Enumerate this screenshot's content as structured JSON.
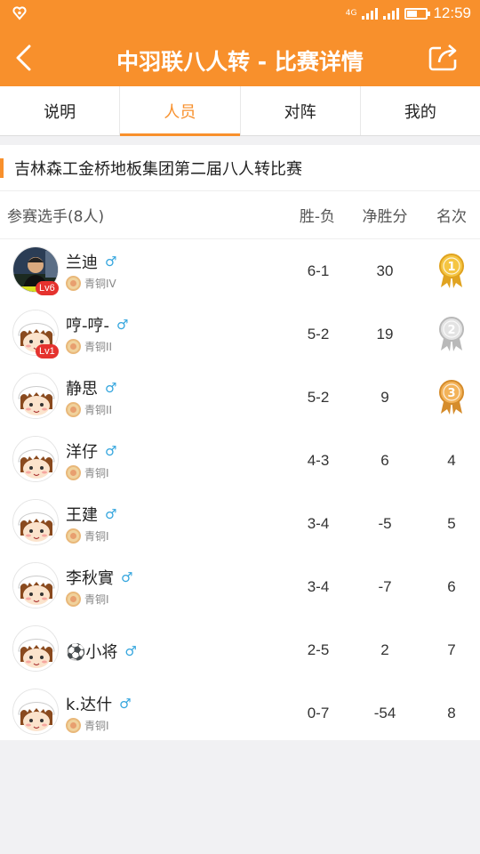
{
  "status_bar": {
    "network": "4G",
    "time": "12:59",
    "battery_level": 0.55
  },
  "navbar": {
    "title": "中羽联八人转 - 比赛详情"
  },
  "tabs": [
    {
      "label": "说明",
      "active": false
    },
    {
      "label": "人员",
      "active": true
    },
    {
      "label": "对阵",
      "active": false
    },
    {
      "label": "我的",
      "active": false
    }
  ],
  "match": {
    "title": "吉林森工金桥地板集团第二届八人转比赛"
  },
  "table": {
    "headers": {
      "name": "参赛选手(8人)",
      "wl": "胜-负",
      "net": "净胜分",
      "rank": "名次"
    },
    "rows": [
      {
        "name": "兰迪",
        "gender": "♂",
        "level": "青铜IV",
        "lv": "Lv6",
        "wl": "6-1",
        "net": "30",
        "rank": "1",
        "rank_badge": "gold-medal-icon"
      },
      {
        "name": "哼-哼-",
        "gender": "♂",
        "level": "青铜II",
        "lv": "Lv1",
        "wl": "5-2",
        "net": "19",
        "rank": "2",
        "rank_badge": "silver-medal-icon"
      },
      {
        "name": "静思",
        "gender": "♂",
        "level": "青铜II",
        "lv": "",
        "wl": "5-2",
        "net": "9",
        "rank": "3",
        "rank_badge": "bronze-medal-icon"
      },
      {
        "name": "洋仔",
        "gender": "♂",
        "level": "青铜I",
        "lv": "",
        "wl": "4-3",
        "net": "6",
        "rank": "4",
        "rank_badge": ""
      },
      {
        "name": "王建",
        "gender": "♂",
        "level": "青铜I",
        "lv": "",
        "wl": "3-4",
        "net": "-5",
        "rank": "5",
        "rank_badge": ""
      },
      {
        "name": "李秋實",
        "gender": "♂",
        "level": "青铜I",
        "lv": "",
        "wl": "3-4",
        "net": "-7",
        "rank": "6",
        "rank_badge": ""
      },
      {
        "name": "⚽小将",
        "gender": "♂",
        "level": "",
        "lv": "",
        "wl": "2-5",
        "net": "2",
        "rank": "7",
        "rank_badge": ""
      },
      {
        "name": "k.达什",
        "gender": "♂",
        "level": "青铜I",
        "lv": "",
        "wl": "0-7",
        "net": "-54",
        "rank": "8",
        "rank_badge": ""
      }
    ]
  },
  "colors": {
    "accent": "#f8902c",
    "male": "#35a6de",
    "lv_badge": "#e5322e"
  }
}
